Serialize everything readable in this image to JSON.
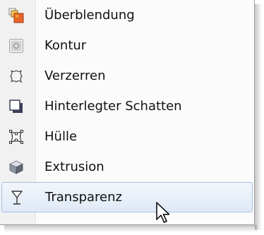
{
  "menu": {
    "items": [
      {
        "label": "Überblendung",
        "icon": "blend-icon"
      },
      {
        "label": "Kontur",
        "icon": "contour-icon"
      },
      {
        "label": "Verzerren",
        "icon": "distort-icon"
      },
      {
        "label": "Hinterlegter Schatten",
        "icon": "drop-shadow-icon"
      },
      {
        "label": "Hülle",
        "icon": "envelope-icon"
      },
      {
        "label": "Extrusion",
        "icon": "extrude-icon"
      },
      {
        "label": "Transparenz",
        "icon": "transparency-icon"
      }
    ],
    "hovered_index": 6
  },
  "colors": {
    "hover_border": "#a9c1e2",
    "hover_fill": "#dfe9f6",
    "blend_orange": "#f4a32a",
    "blend_red": "#d9481f"
  }
}
